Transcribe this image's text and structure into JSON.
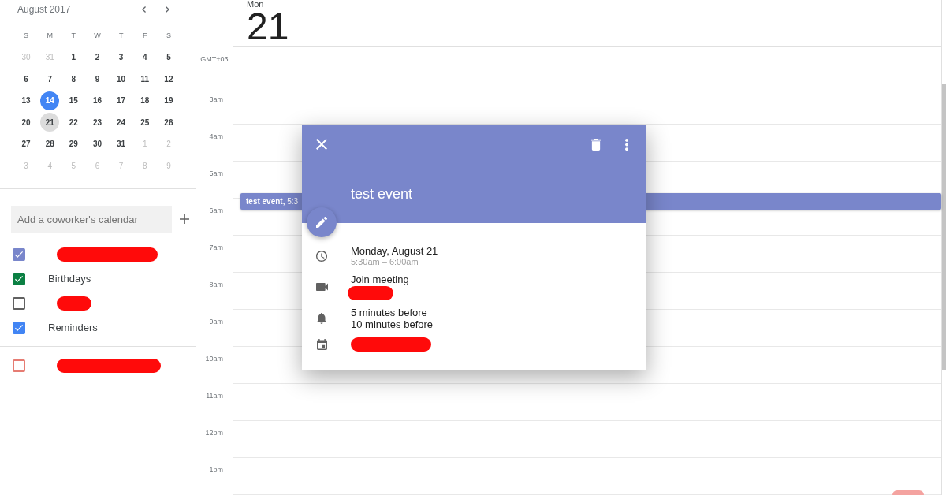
{
  "mini_calendar": {
    "title": "August 2017",
    "weekdays": [
      "S",
      "M",
      "T",
      "W",
      "T",
      "F",
      "S"
    ],
    "weeks": [
      [
        {
          "label": "30",
          "outside": true,
          "today": false,
          "selected": false
        },
        {
          "label": "31",
          "outside": true,
          "today": false,
          "selected": false
        },
        {
          "label": "1",
          "outside": false,
          "today": false,
          "selected": false
        },
        {
          "label": "2",
          "outside": false,
          "today": false,
          "selected": false
        },
        {
          "label": "3",
          "outside": false,
          "today": false,
          "selected": false
        },
        {
          "label": "4",
          "outside": false,
          "today": false,
          "selected": false
        },
        {
          "label": "5",
          "outside": false,
          "today": false,
          "selected": false
        }
      ],
      [
        {
          "label": "6",
          "outside": false,
          "today": false,
          "selected": false
        },
        {
          "label": "7",
          "outside": false,
          "today": false,
          "selected": false
        },
        {
          "label": "8",
          "outside": false,
          "today": false,
          "selected": false
        },
        {
          "label": "9",
          "outside": false,
          "today": false,
          "selected": false
        },
        {
          "label": "10",
          "outside": false,
          "today": false,
          "selected": false
        },
        {
          "label": "11",
          "outside": false,
          "today": false,
          "selected": false
        },
        {
          "label": "12",
          "outside": false,
          "today": false,
          "selected": false
        }
      ],
      [
        {
          "label": "13",
          "outside": false,
          "today": false,
          "selected": false
        },
        {
          "label": "14",
          "outside": false,
          "today": true,
          "selected": false
        },
        {
          "label": "15",
          "outside": false,
          "today": false,
          "selected": false
        },
        {
          "label": "16",
          "outside": false,
          "today": false,
          "selected": false
        },
        {
          "label": "17",
          "outside": false,
          "today": false,
          "selected": false
        },
        {
          "label": "18",
          "outside": false,
          "today": false,
          "selected": false
        },
        {
          "label": "19",
          "outside": false,
          "today": false,
          "selected": false
        }
      ],
      [
        {
          "label": "20",
          "outside": false,
          "today": false,
          "selected": false
        },
        {
          "label": "21",
          "outside": false,
          "today": false,
          "selected": true
        },
        {
          "label": "22",
          "outside": false,
          "today": false,
          "selected": false
        },
        {
          "label": "23",
          "outside": false,
          "today": false,
          "selected": false
        },
        {
          "label": "24",
          "outside": false,
          "today": false,
          "selected": false
        },
        {
          "label": "25",
          "outside": false,
          "today": false,
          "selected": false
        },
        {
          "label": "26",
          "outside": false,
          "today": false,
          "selected": false
        }
      ],
      [
        {
          "label": "27",
          "outside": false,
          "today": false,
          "selected": false
        },
        {
          "label": "28",
          "outside": false,
          "today": false,
          "selected": false
        },
        {
          "label": "29",
          "outside": false,
          "today": false,
          "selected": false
        },
        {
          "label": "30",
          "outside": false,
          "today": false,
          "selected": false
        },
        {
          "label": "31",
          "outside": false,
          "today": false,
          "selected": false
        },
        {
          "label": "1",
          "outside": true,
          "today": false,
          "selected": false
        },
        {
          "label": "2",
          "outside": true,
          "today": false,
          "selected": false
        }
      ],
      [
        {
          "label": "3",
          "outside": true,
          "today": false,
          "selected": false
        },
        {
          "label": "4",
          "outside": true,
          "today": false,
          "selected": false
        },
        {
          "label": "5",
          "outside": true,
          "today": false,
          "selected": false
        },
        {
          "label": "6",
          "outside": true,
          "today": false,
          "selected": false
        },
        {
          "label": "7",
          "outside": true,
          "today": false,
          "selected": false
        },
        {
          "label": "8",
          "outside": true,
          "today": false,
          "selected": false
        },
        {
          "label": "9",
          "outside": true,
          "today": false,
          "selected": false
        }
      ]
    ]
  },
  "add_calendar": {
    "placeholder": "Add a coworker's calendar"
  },
  "calendars": [
    {
      "redacted": true,
      "checked": true,
      "color": "#7986cb"
    },
    {
      "label": "Birthdays",
      "redacted": false,
      "checked": true,
      "color": "#0b8043"
    },
    {
      "redacted": true,
      "checked": false,
      "color": "#616161"
    },
    {
      "label": "Reminders",
      "redacted": false,
      "checked": true,
      "color": "#4285f4"
    }
  ],
  "other_calendars": [
    {
      "redacted": true,
      "checked": false,
      "color": "#e67c73"
    }
  ],
  "day_view": {
    "weekday": "Mon",
    "date": "21",
    "timezone": "GMT+03",
    "hours": [
      "3am",
      "4am",
      "5am",
      "6am",
      "7am",
      "8am",
      "9am",
      "10am",
      "11am",
      "12pm",
      "1pm"
    ]
  },
  "event_chip": {
    "text": "**test event,** 5:3"
  },
  "event_popup": {
    "title": "test event",
    "rows": [
      {
        "kind": "time",
        "text": "Monday, August 21",
        "subtext": "5:30am – 6:00am",
        "redacted": false
      },
      {
        "kind": "video",
        "text": "Join meeting",
        "redacted": true
      },
      {
        "kind": "reminder",
        "lines": [
          "5 minutes before",
          "10 minutes before"
        ],
        "redacted": false
      },
      {
        "kind": "calendar",
        "redacted": true
      }
    ]
  }
}
